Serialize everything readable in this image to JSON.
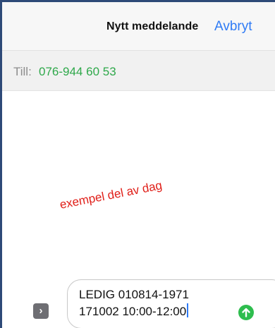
{
  "header": {
    "title": "Nytt meddelande",
    "cancel_label": "Avbryt"
  },
  "recipient": {
    "label": "Till:",
    "value": "076-944 60 53"
  },
  "annotation": "exempel del av dag",
  "composer": {
    "line1": "LEDIG 010814-1971",
    "line2": "171002 10:00-12:00"
  },
  "colors": {
    "accent": "#2f7bf5",
    "recipient": "#2ea84a",
    "annotation": "#e0201a",
    "send": "#2ebd4e"
  },
  "icons": {
    "expand": "chevron-right-icon",
    "send": "arrow-up-icon"
  }
}
